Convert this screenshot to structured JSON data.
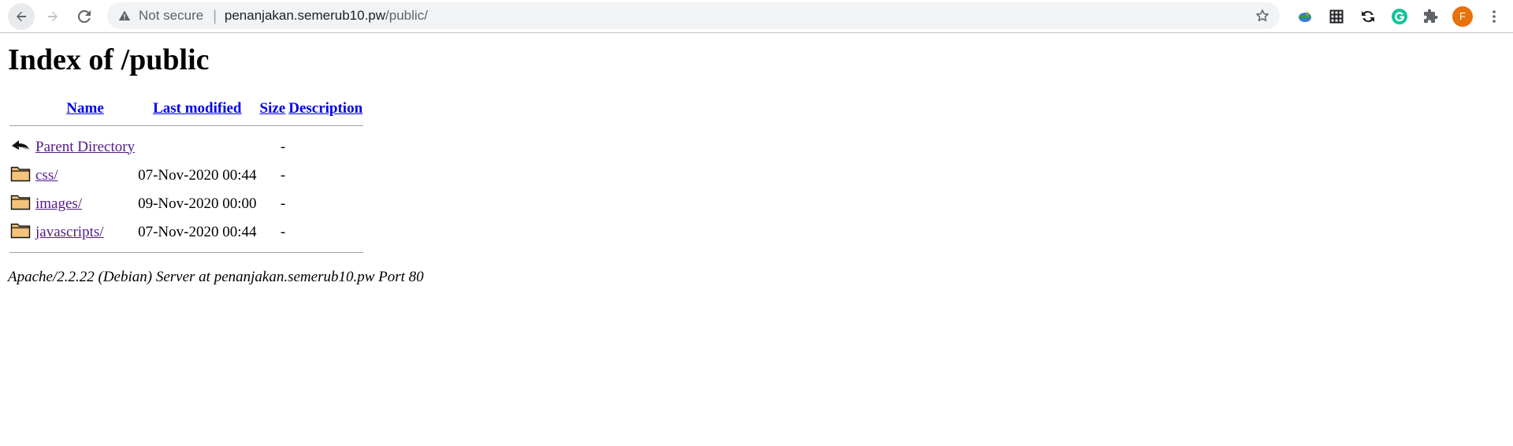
{
  "browser": {
    "security_label": "Not secure",
    "url_host": "penanjakan.semerub10.pw",
    "url_path": "/public/",
    "avatar_letter": "F"
  },
  "page": {
    "title": "Index of /public",
    "columns": {
      "name": "Name",
      "last_modified": "Last modified",
      "size": "Size",
      "description": "Description"
    },
    "rows": [
      {
        "name": "Parent Directory",
        "modified": "",
        "size": "-",
        "icon": "back-icon"
      },
      {
        "name": "css/",
        "modified": "07-Nov-2020 00:44",
        "size": "-",
        "icon": "folder-icon"
      },
      {
        "name": "images/",
        "modified": "09-Nov-2020 00:00",
        "size": "-",
        "icon": "folder-icon"
      },
      {
        "name": "javascripts/",
        "modified": "07-Nov-2020 00:44",
        "size": "-",
        "icon": "folder-icon"
      }
    ],
    "footer": "Apache/2.2.22 (Debian) Server at penanjakan.semerub10.pw Port 80"
  },
  "colors": {
    "link_unvisited": "#0000ee",
    "link_visited": "#551a8b",
    "avatar": "#e8710a"
  }
}
